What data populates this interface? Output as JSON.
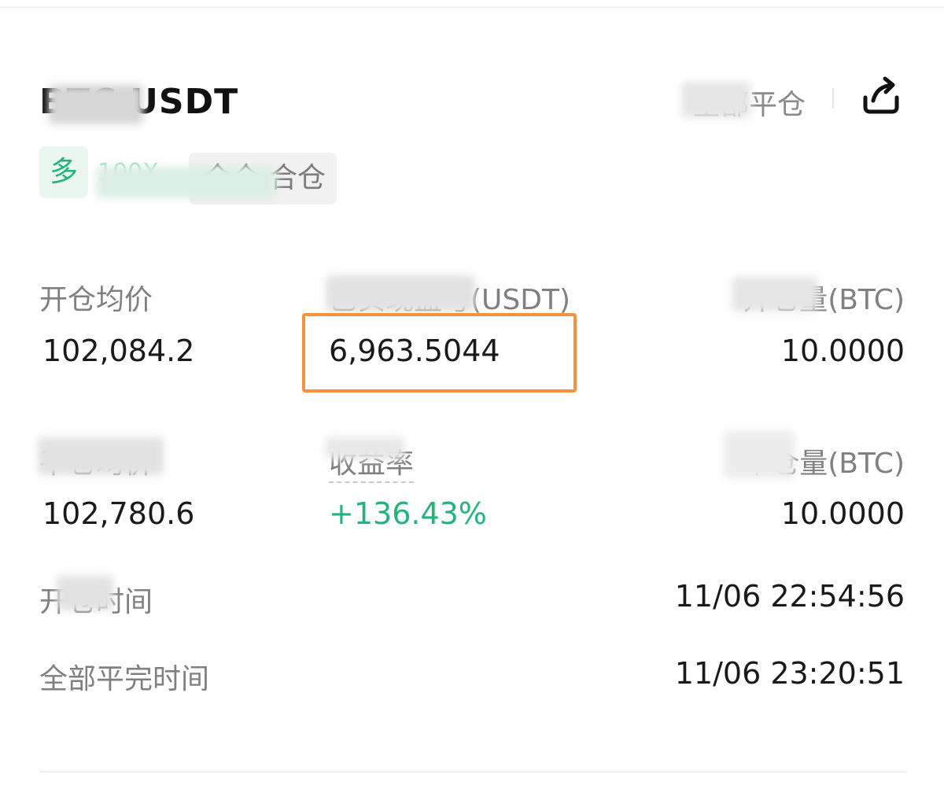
{
  "header": {
    "symbol": "BTC USDT",
    "close_all_label": "全部平仓",
    "share_icon": "share-icon"
  },
  "tags": {
    "direction": "多",
    "leverage": "100X",
    "margin_mode": "全仓 合仓"
  },
  "stats_row1": [
    {
      "label": "开仓均价",
      "value": "102,084.2"
    },
    {
      "label": "已实现盈亏(USDT)",
      "value": "6,963.5044"
    },
    {
      "label": "开仓量(BTC)",
      "value": "10.0000"
    }
  ],
  "stats_row2": [
    {
      "label": "平仓均价",
      "value": "102,780.6"
    },
    {
      "label": "收益率",
      "value": "+136.43%"
    },
    {
      "label": "平仓量(BTC)",
      "value": "10.0000"
    }
  ],
  "times": [
    {
      "label": "开仓时间",
      "value": "11/06 22:54:56"
    },
    {
      "label": "全部平完时间",
      "value": "11/06 23:20:51"
    }
  ],
  "colors": {
    "profit_green": "#22b47a",
    "highlight_orange": "#f5923e",
    "label_gray": "#808080"
  }
}
